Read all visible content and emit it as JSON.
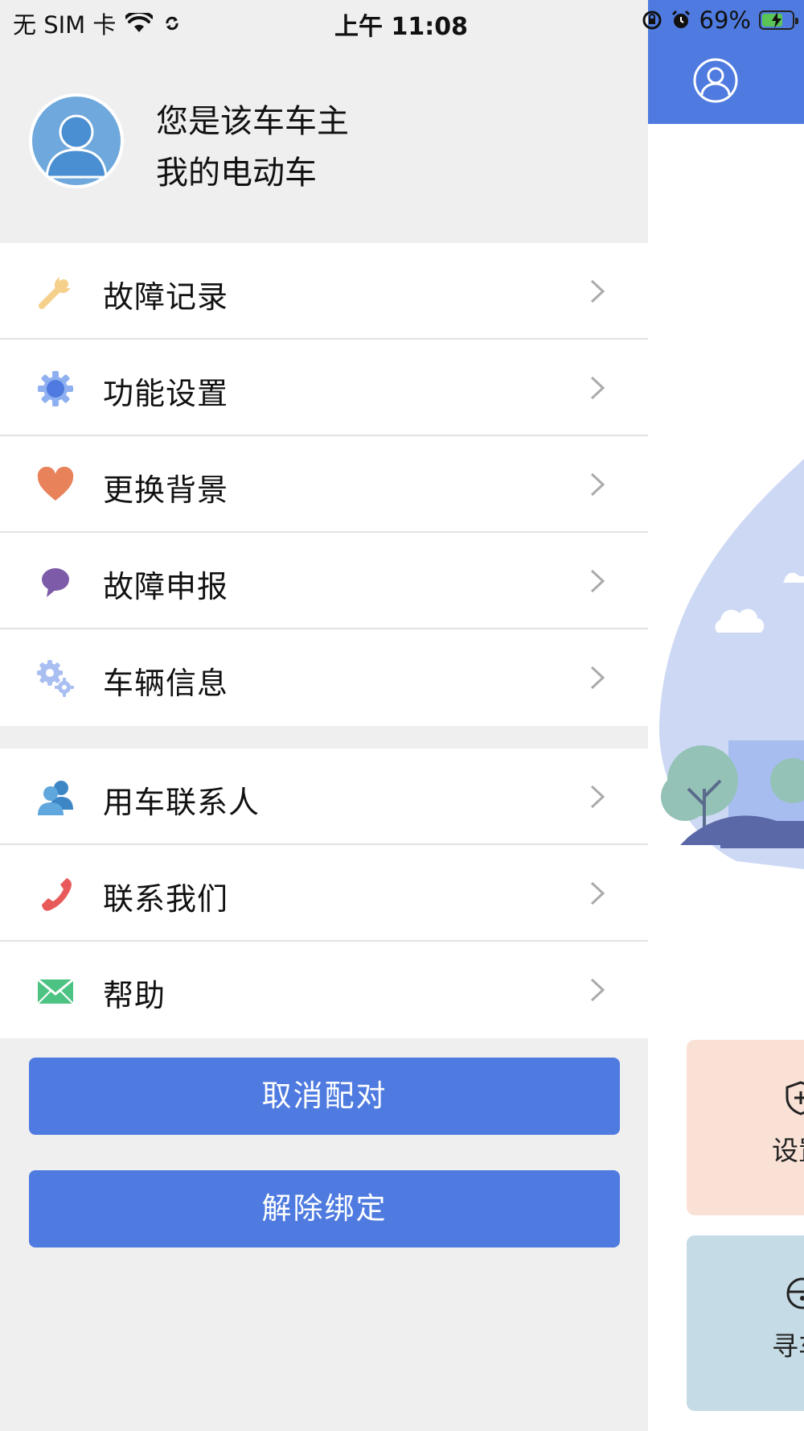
{
  "status_bar": {
    "carrier": "无 SIM 卡",
    "time": "上午 11:08",
    "battery_percent": "69%",
    "battery_level": 0.69
  },
  "drawer": {
    "profile": {
      "owner_status": "您是该车车主",
      "vehicle_name": "我的电动车"
    },
    "menu_group_1": [
      {
        "label": "故障记录",
        "icon": "wrench-icon"
      },
      {
        "label": "功能设置",
        "icon": "gear-icon"
      },
      {
        "label": "更换背景",
        "icon": "heart-icon"
      },
      {
        "label": "故障申报",
        "icon": "chat-bubble-icon"
      },
      {
        "label": "车辆信息",
        "icon": "gears-icon"
      }
    ],
    "menu_group_2": [
      {
        "label": "用车联系人",
        "icon": "contacts-icon"
      },
      {
        "label": "联系我们",
        "icon": "phone-icon"
      },
      {
        "label": "帮助",
        "icon": "mail-icon"
      }
    ],
    "buttons": {
      "unpair": "取消配对",
      "unbind": "解除绑定"
    }
  },
  "background_screen": {
    "card_1_label": "设置",
    "card_2_label": "寻车"
  },
  "colors": {
    "accent": "#4f7be0",
    "drawer_bg": "#efefef",
    "card_1_bg": "#f9e1d6",
    "card_2_bg": "#c5dbe5"
  }
}
